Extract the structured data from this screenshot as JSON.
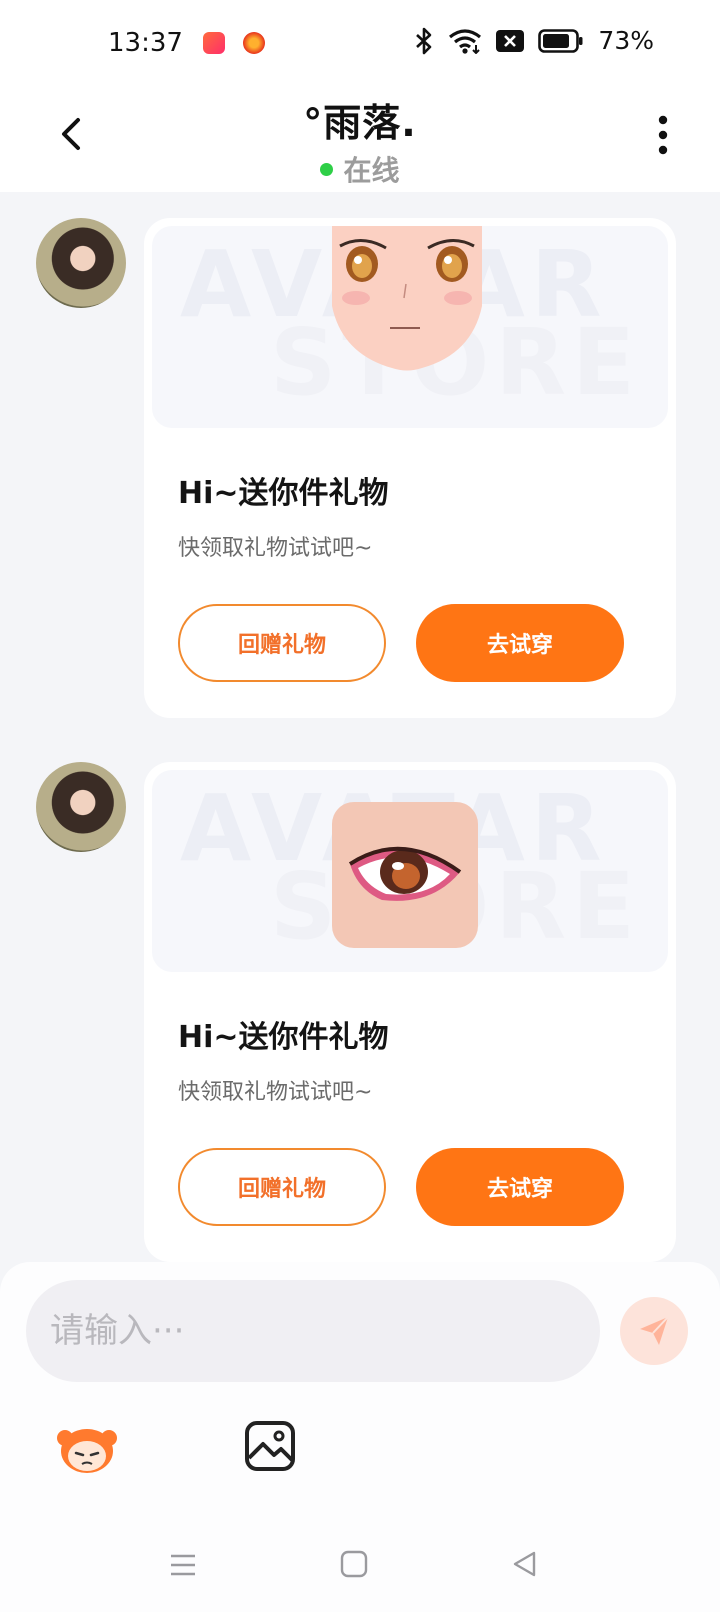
{
  "status_bar": {
    "time": "13:37",
    "battery_percent": "73%",
    "icons": [
      "game-app-icon",
      "orange-app-icon",
      "bluetooth-icon",
      "wifi-icon",
      "sim-off-icon",
      "battery-icon"
    ]
  },
  "header": {
    "title": "°雨落.",
    "status": "在线",
    "status_color": "#2ecf47"
  },
  "messages": [
    {
      "gift_image": "anime-face-gift",
      "watermark_line1": "AVATAR",
      "watermark_line2": "STORE",
      "title": "Hi~送你件礼物",
      "subtitle": "快领取礼物试试吧~",
      "return_label": "回赠礼物",
      "try_label": "去试穿"
    },
    {
      "gift_image": "anime-eye-gift",
      "watermark_line1": "AVATAR",
      "watermark_line2": "STORE",
      "title": "Hi~送你件礼物",
      "subtitle": "快领取礼物试试吧~",
      "return_label": "回赠礼物",
      "try_label": "去试穿"
    }
  ],
  "composer": {
    "placeholder": "请输入···"
  },
  "colors": {
    "accent": "#ff7514",
    "accent_outline": "#f28a2e",
    "background": "#f4f5f8"
  }
}
